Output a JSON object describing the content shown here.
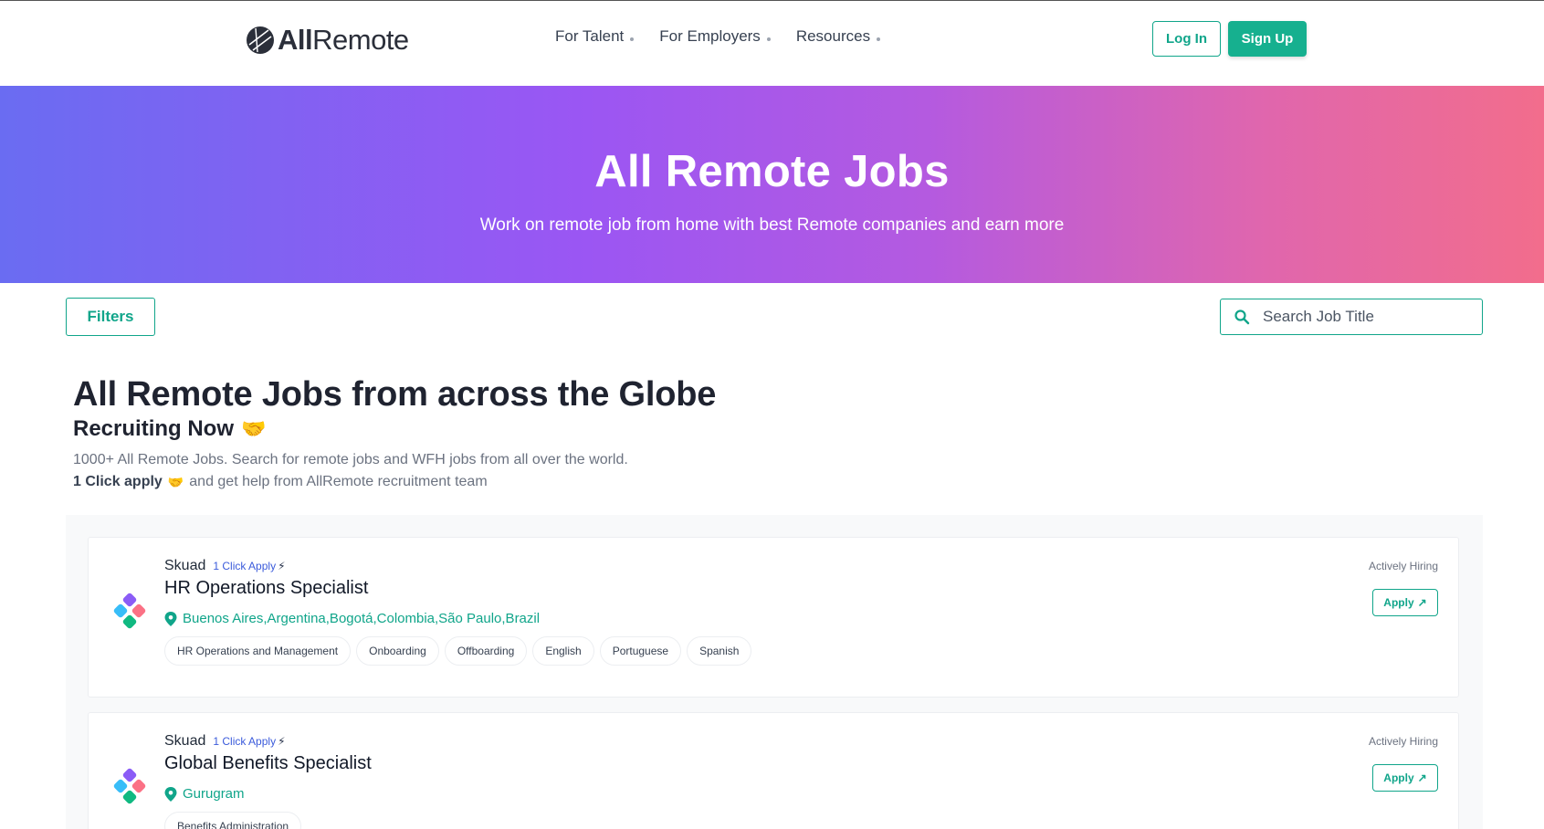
{
  "header": {
    "logo_bold": "All",
    "logo_light": "Remote",
    "nav": [
      {
        "label": "For Talent"
      },
      {
        "label": "For Employers"
      },
      {
        "label": "Resources"
      }
    ],
    "login_label": "Log In",
    "signup_label": "Sign Up"
  },
  "hero": {
    "title": "All Remote Jobs",
    "subtitle": "Work on remote job from home with best Remote companies and earn more"
  },
  "toolbar": {
    "filters_label": "Filters",
    "search_placeholder": "Search Job Title"
  },
  "intro": {
    "title": "All Remote Jobs from across the Globe",
    "subtitle": "Recruiting Now",
    "emoji": "🤝",
    "description": "1000+ All Remote Jobs. Search for remote jobs and WFH jobs from all over the world.",
    "apply_bold": "1 Click apply",
    "apply_rest": "and get help from AllRemote recruitment team"
  },
  "jobs": [
    {
      "company": "Skuad",
      "one_click": "1 Click Apply",
      "title": "HR Operations Specialist",
      "location": "Buenos Aires,Argentina,Bogotá,Colombia,São Paulo,Brazil",
      "tags": [
        "HR Operations and Management",
        "Onboarding",
        "Offboarding",
        "English",
        "Portuguese",
        "Spanish"
      ],
      "status": "Actively Hiring",
      "apply_label": "Apply"
    },
    {
      "company": "Skuad",
      "one_click": "1 Click Apply",
      "title": "Global Benefits Specialist",
      "location": "Gurugram",
      "tags": [
        "Benefits Administration"
      ],
      "status": "Actively Hiring",
      "apply_label": "Apply"
    }
  ],
  "colors": {
    "accent": "#10a58a",
    "link_blue": "#3b5bdb",
    "hero_start": "#6a6cf2",
    "hero_mid": "#9b56f3",
    "hero_end": "#f26d8c"
  }
}
